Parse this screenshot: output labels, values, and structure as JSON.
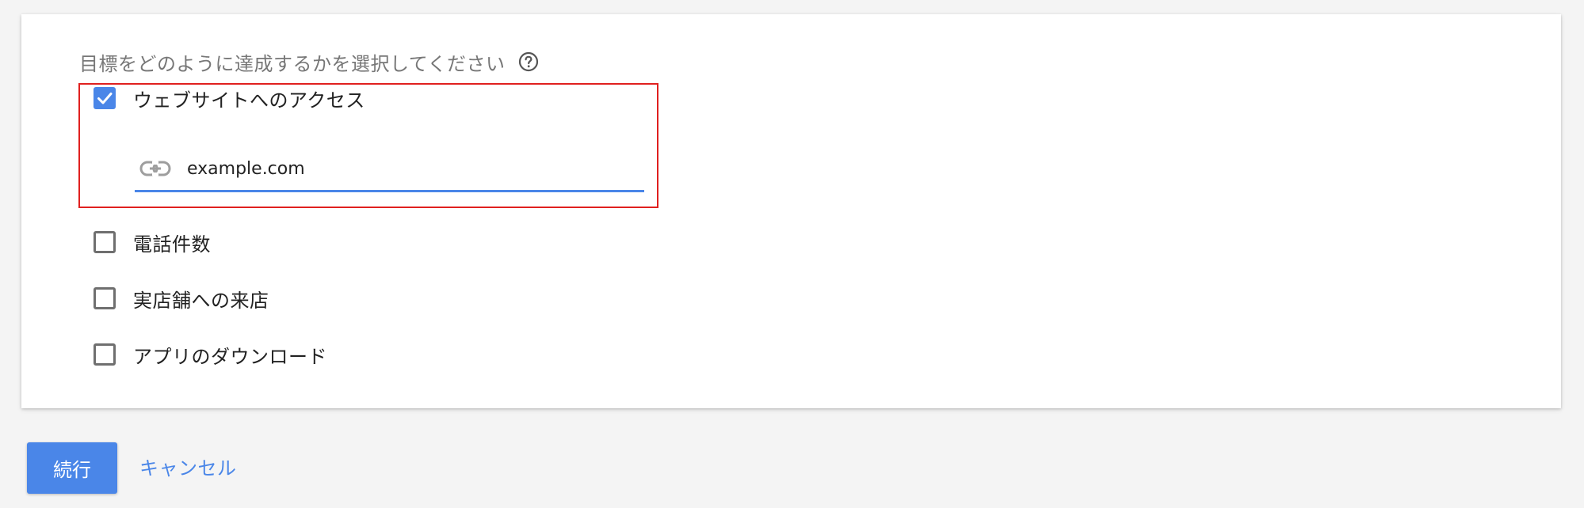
{
  "form": {
    "question": "目標をどのように達成するかを選択してください",
    "help_icon": "help-circle-icon",
    "options": [
      {
        "label": "ウェブサイトへのアクセス",
        "checked": true
      },
      {
        "label": "電話件数",
        "checked": false
      },
      {
        "label": "実店舗への来店",
        "checked": false
      },
      {
        "label": "アプリのダウンロード",
        "checked": false
      }
    ],
    "website_url": {
      "value": "example.com",
      "icon": "link-icon"
    }
  },
  "actions": {
    "continue_label": "続行",
    "cancel_label": "キャンセル"
  },
  "colors": {
    "accent": "#4a86e8",
    "highlight_border": "#e0201f"
  }
}
